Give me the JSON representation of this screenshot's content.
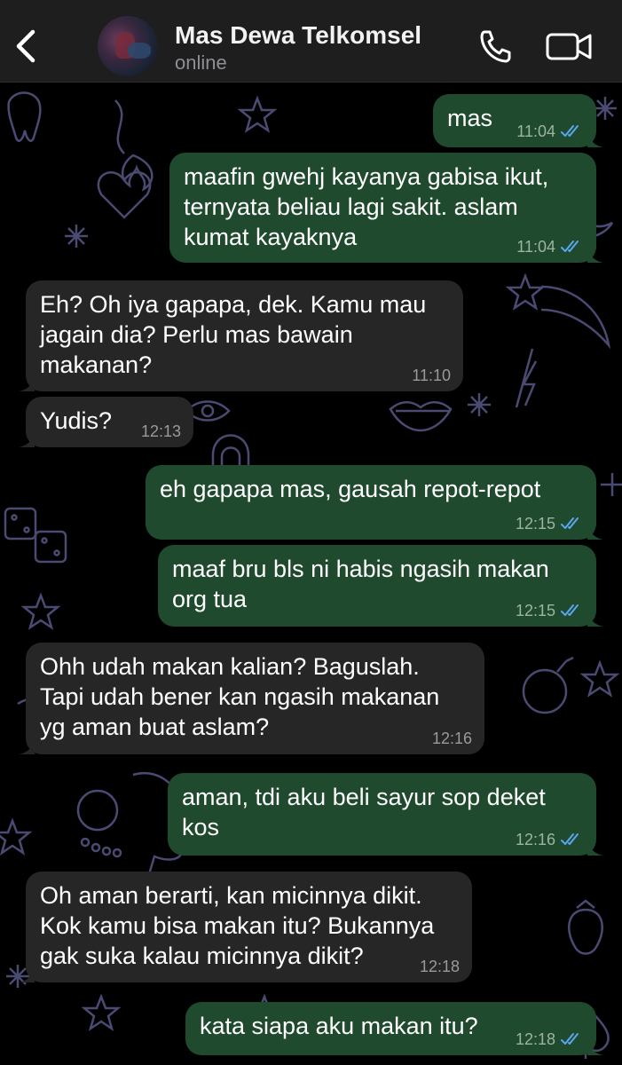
{
  "header": {
    "back_icon": "chevron-left-icon",
    "avatar_icon": "contact-avatar",
    "name": "Mas Dewa Telkomsel",
    "status": "online",
    "call_icon": "phone-icon",
    "video_icon": "video-camera-icon"
  },
  "colors": {
    "header_bg": "#1e1e1e",
    "chat_bg": "#000000",
    "outgoing_bubble": "#1f4a2e",
    "incoming_bubble": "#262626",
    "read_tick": "#5aa7f0",
    "wallpaper_stroke": "#4a4a72"
  },
  "messages": [
    {
      "direction": "out",
      "text": "mas",
      "time": "11:04",
      "status": "read"
    },
    {
      "direction": "out",
      "text": "maafin gwehj kayanya gabisa ikut,\nternyata beliau lagi sakit. aslam\nkumat kayaknya",
      "time": "11:04",
      "status": "read"
    },
    {
      "direction": "in",
      "text": "Eh? Oh iya gapapa, dek. Kamu mau\njagain dia? Perlu mas bawain\nmakanan?",
      "time": "11:10"
    },
    {
      "direction": "in",
      "text": "Yudis?",
      "time": "12:13"
    },
    {
      "direction": "out",
      "text": "eh gapapa mas, gausah repot-repot",
      "time": "12:15",
      "status": "read"
    },
    {
      "direction": "out",
      "text": "maaf bru bls ni habis ngasih makan\norg tua",
      "time": "12:15",
      "status": "read"
    },
    {
      "direction": "in",
      "text": "Ohh udah makan kalian? Baguslah.\nTapi udah bener kan ngasih makanan\nyg aman buat aslam?",
      "time": "12:16"
    },
    {
      "direction": "out",
      "text": "aman, tdi aku beli sayur sop deket\nkos",
      "time": "12:16",
      "status": "read"
    },
    {
      "direction": "in",
      "text": "Oh aman berarti, kan micinnya dikit.\nKok kamu bisa makan itu? Bukannya\ngak suka kalau micinnya dikit?",
      "time": "12:18"
    },
    {
      "direction": "out",
      "text": "kata siapa aku makan itu?",
      "time": "12:18",
      "status": "read"
    }
  ]
}
